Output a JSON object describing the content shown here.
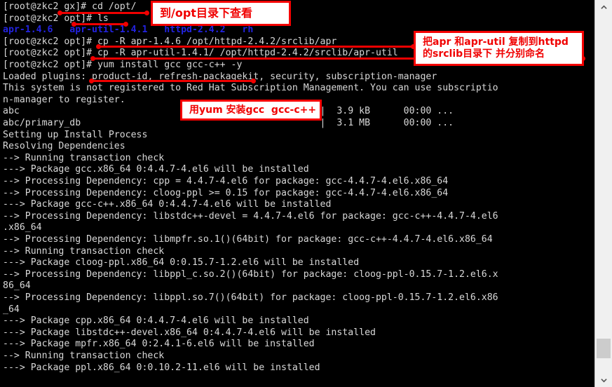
{
  "window": {
    "type": "terminal-emulator",
    "colors": {
      "background": "#000000",
      "foreground": "#d8d8d8",
      "directory_blue": "#2323e0",
      "annotation_red": "#f00000",
      "callout_background": "#ffffff",
      "scrollbar_track": "#f0f0f0",
      "scrollbar_thumb": "#cccccc"
    }
  },
  "terminal": {
    "prompt_user": "root",
    "prompt_host": "zkc2",
    "lines": [
      {
        "text": "[root@zkc2 gx]# cd /opt/",
        "color": "fg"
      },
      {
        "text": "[root@zkc2 opt]# ls",
        "color": "fg"
      },
      {
        "text": "apr-1.4.6   apr-util-1.4.1   httpd-2.4.2   rh",
        "color": "blue"
      },
      {
        "text": "[root@zkc2 opt]# cp -R apr-1.4.6 /opt/httpd-2.4.2/srclib/apr",
        "color": "fg"
      },
      {
        "text": "[root@zkc2 opt]# cp -R apr-util-1.4.1/ /opt/httpd-2.4.2/srclib/apr-util",
        "color": "fg"
      },
      {
        "text": "[root@zkc2 opt]# yum install gcc gcc-c++ -y",
        "color": "fg"
      },
      {
        "text": "Loaded plugins: product-id, refresh-packagekit, security, subscription-manager",
        "color": "fg"
      },
      {
        "text": "This system is not registered to Red Hat Subscription Management. You can use subscriptio",
        "color": "fg"
      },
      {
        "text": "n-manager to register.",
        "color": "fg"
      },
      {
        "text": "abc                                                      |  3.9 kB      00:00 ...",
        "color": "fg"
      },
      {
        "text": "abc/primary_db                                           |  3.1 MB      00:00 ...",
        "color": "fg"
      },
      {
        "text": "Setting up Install Process",
        "color": "fg"
      },
      {
        "text": "Resolving Dependencies",
        "color": "fg"
      },
      {
        "text": "--> Running transaction check",
        "color": "fg"
      },
      {
        "text": "---> Package gcc.x86_64 0:4.4.7-4.el6 will be installed",
        "color": "fg"
      },
      {
        "text": "--> Processing Dependency: cpp = 4.4.7-4.el6 for package: gcc-4.4.7-4.el6.x86_64",
        "color": "fg"
      },
      {
        "text": "--> Processing Dependency: cloog-ppl >= 0.15 for package: gcc-4.4.7-4.el6.x86_64",
        "color": "fg"
      },
      {
        "text": "---> Package gcc-c++.x86_64 0:4.4.7-4.el6 will be installed",
        "color": "fg"
      },
      {
        "text": "--> Processing Dependency: libstdc++-devel = 4.4.7-4.el6 for package: gcc-c++-4.4.7-4.el6",
        "color": "fg"
      },
      {
        "text": ".x86_64",
        "color": "fg"
      },
      {
        "text": "--> Processing Dependency: libmpfr.so.1()(64bit) for package: gcc-c++-4.4.7-4.el6.x86_64",
        "color": "fg"
      },
      {
        "text": "--> Running transaction check",
        "color": "fg"
      },
      {
        "text": "---> Package cloog-ppl.x86_64 0:0.15.7-1.2.el6 will be installed",
        "color": "fg"
      },
      {
        "text": "--> Processing Dependency: libppl_c.so.2()(64bit) for package: cloog-ppl-0.15.7-1.2.el6.x",
        "color": "fg"
      },
      {
        "text": "86_64",
        "color": "fg"
      },
      {
        "text": "--> Processing Dependency: libppl.so.7()(64bit) for package: cloog-ppl-0.15.7-1.2.el6.x86",
        "color": "fg"
      },
      {
        "text": "_64",
        "color": "fg"
      },
      {
        "text": "---> Package cpp.x86_64 0:4.4.7-4.el6 will be installed",
        "color": "fg"
      },
      {
        "text": "---> Package libstdc++-devel.x86_64 0:4.4.7-4.el6 will be installed",
        "color": "fg"
      },
      {
        "text": "---> Package mpfr.x86_64 0:2.4.1-6.el6 will be installed",
        "color": "fg"
      },
      {
        "text": "--> Running transaction check",
        "color": "fg"
      },
      {
        "text": "---> Package ppl.x86_64 0:0.10.2-11.el6 will be installed",
        "color": "fg"
      }
    ]
  },
  "annotations": {
    "callouts": [
      {
        "id": "callout-cd-opt",
        "lines": [
          "到/opt目录下查看"
        ],
        "font_size": 16
      },
      {
        "id": "callout-copy-srclib",
        "lines": [
          "把apr 和apr-util 复制到httpd",
          "的srclib目录下 并分别命名"
        ],
        "font_size": 14
      },
      {
        "id": "callout-yum-gcc",
        "lines": [
          "用yum 安装gcc  gcc-c++"
        ],
        "font_size": 14
      }
    ],
    "leader_lines": [
      {
        "id": "leader-cd-opt"
      },
      {
        "id": "leader-ls"
      },
      {
        "id": "leader-cp-apr"
      },
      {
        "id": "leader-cp-apr-util"
      },
      {
        "id": "leader-yum"
      }
    ]
  },
  "scrollbar": {
    "up_arrow": "chevron-up-icon",
    "down_arrow": "chevron-down-icon",
    "thumb_position": "near-bottom"
  }
}
